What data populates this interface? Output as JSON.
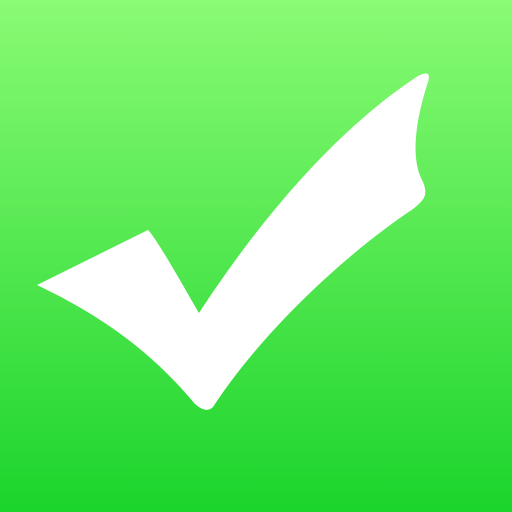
{
  "icon": {
    "name": "checkmark-icon",
    "colors": {
      "gradient_top": "#8AFB74",
      "gradient_bottom": "#1BD42C",
      "checkmark": "#FFFFFF"
    }
  }
}
